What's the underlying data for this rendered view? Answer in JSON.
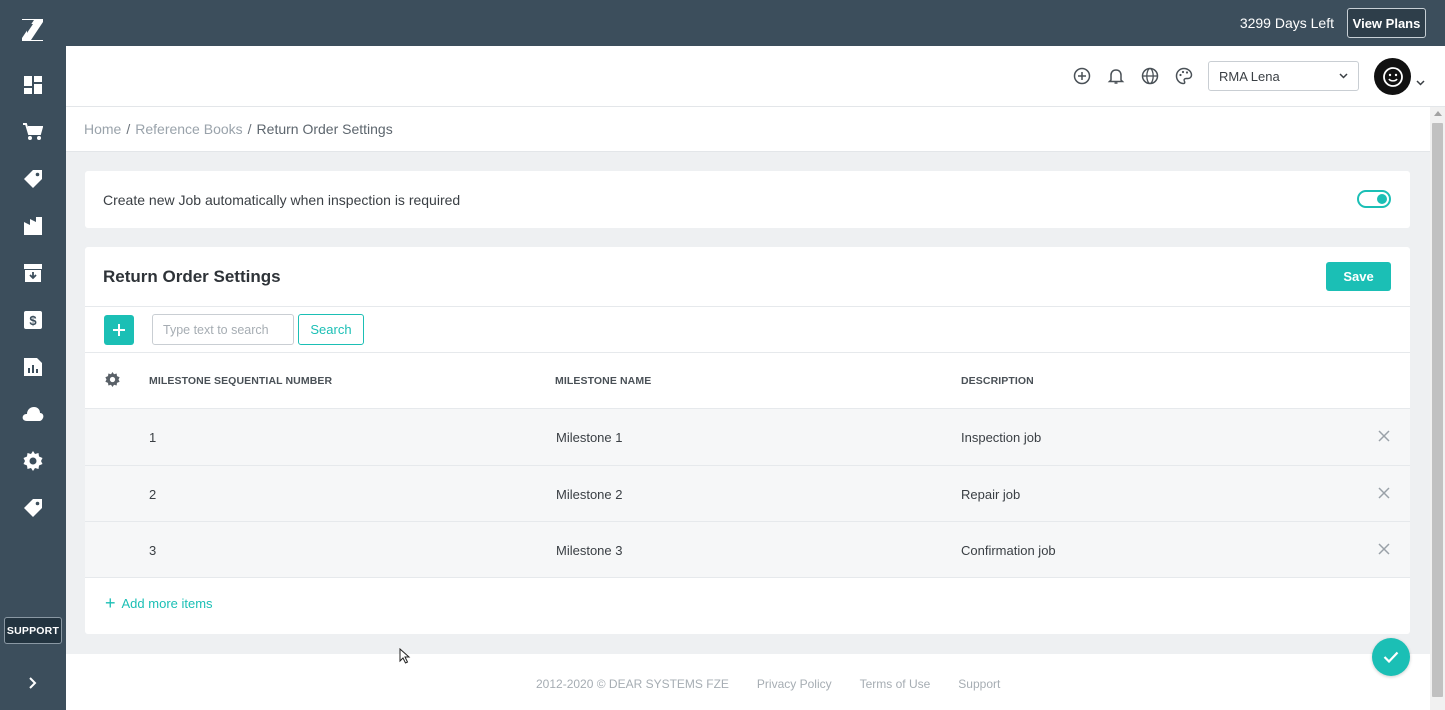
{
  "topbar": {
    "days_left": "3299 Days Left",
    "view_plans_label": "View Plans"
  },
  "sidebar": {
    "items": [
      {
        "name": "dashboard-icon"
      },
      {
        "name": "cart-icon"
      },
      {
        "name": "tag-icon"
      },
      {
        "name": "factory-icon"
      },
      {
        "name": "inbox-download-icon"
      },
      {
        "name": "dollar-icon"
      },
      {
        "name": "report-icon"
      },
      {
        "name": "cloud-icon"
      },
      {
        "name": "gear-icon"
      },
      {
        "name": "tag-icon"
      }
    ],
    "support_label": "SUPPORT"
  },
  "header": {
    "icons": [
      "plus-circle-icon",
      "bell-icon",
      "globe-icon",
      "palette-icon"
    ],
    "company_select": "RMA Lena"
  },
  "breadcrumb": {
    "home": "Home",
    "ref_books": "Reference Books",
    "current": "Return Order Settings",
    "separator": "/"
  },
  "toggle_card": {
    "text": "Create new Job automatically when inspection is required",
    "enabled": true
  },
  "main": {
    "title": "Return Order Settings",
    "save_label": "Save",
    "search": {
      "placeholder": "Type text to search",
      "value": "",
      "button_label": "Search"
    },
    "columns": {
      "seq": "MILESTONE SEQUENTIAL NUMBER",
      "name": "MILESTONE NAME",
      "desc": "DESCRIPTION"
    },
    "rows": [
      {
        "seq": "1",
        "name": "Milestone 1",
        "desc": "Inspection job"
      },
      {
        "seq": "2",
        "name": "Milestone 2",
        "desc": "Repair job"
      },
      {
        "seq": "3",
        "name": "Milestone 3",
        "desc": "Confirmation job"
      }
    ],
    "add_more_label": "Add more items"
  },
  "footer": {
    "copyright": "2012-2020 © DEAR SYSTEMS FZE",
    "privacy": "Privacy Policy",
    "terms": "Terms of Use",
    "support": "Support"
  },
  "colors": {
    "accent": "#1bbfb5",
    "sidebar": "#3c4e5c"
  }
}
